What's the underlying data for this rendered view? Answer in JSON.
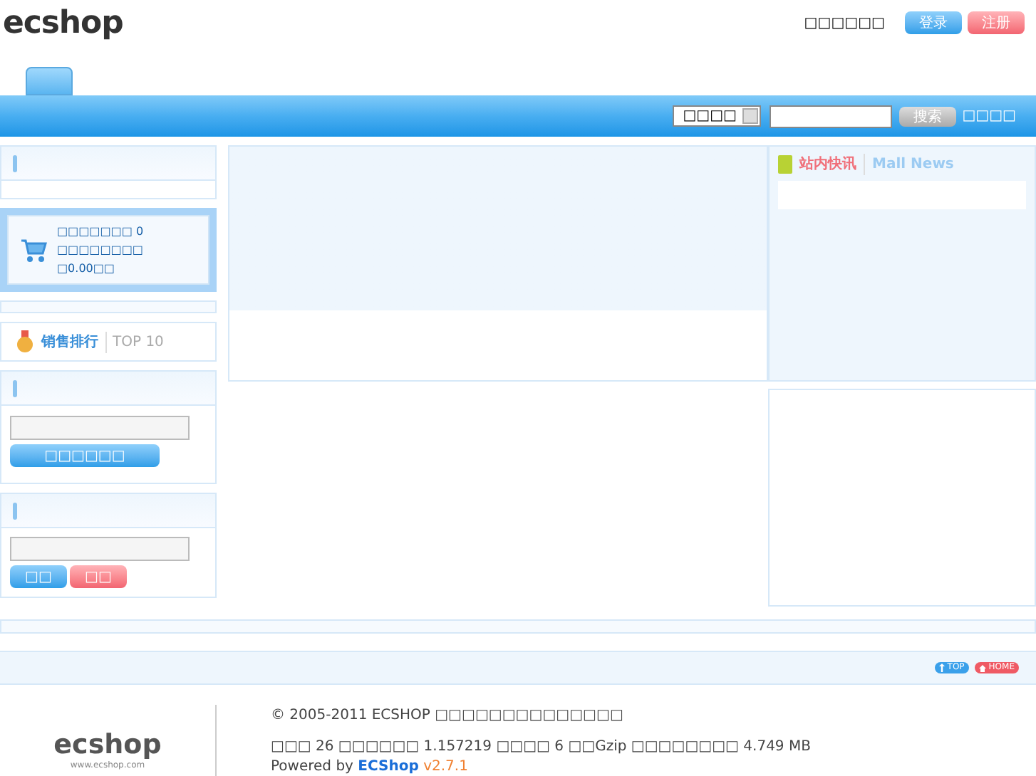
{
  "header": {
    "logo": "ecshop",
    "welcome": "□□□□□□",
    "login_button": "登录",
    "register_button": "注册"
  },
  "nav": {
    "tabs": [
      {
        "selected": true
      }
    ]
  },
  "search": {
    "category": "□□□□",
    "button": "搜索",
    "advanced_link": "□□□□"
  },
  "cart": {
    "text": "□□□□□□□ 0 □□□□□□□□ □0.00□□"
  },
  "top10": {
    "title": "销售排行",
    "subtitle": "TOP 10"
  },
  "order_query": {
    "button": "□□□□□□"
  },
  "email": {
    "buttons": [
      {
        "label": "□□",
        "kind": "primary"
      },
      {
        "label": "□□",
        "kind": "danger"
      }
    ]
  },
  "news": {
    "title": "站内快讯",
    "subtitle": "Mall News"
  },
  "footer_bar": {
    "top_button": "TOP",
    "home_button": "HOME"
  },
  "footer": {
    "logo": "ecshop",
    "logo_url": "www.ecshop.com",
    "copyright": "© 2005-2011 ECSHOP □□□□□□□□□□□□□□",
    "stats": "□□□ 26 □□□□□□ 1.157219 □□□□ 6 □□Gzip □□□□□□□□ 4.749 MB",
    "powered_by": "Powered by",
    "powered_name": "ECShop",
    "powered_version": "v2.7.1"
  }
}
